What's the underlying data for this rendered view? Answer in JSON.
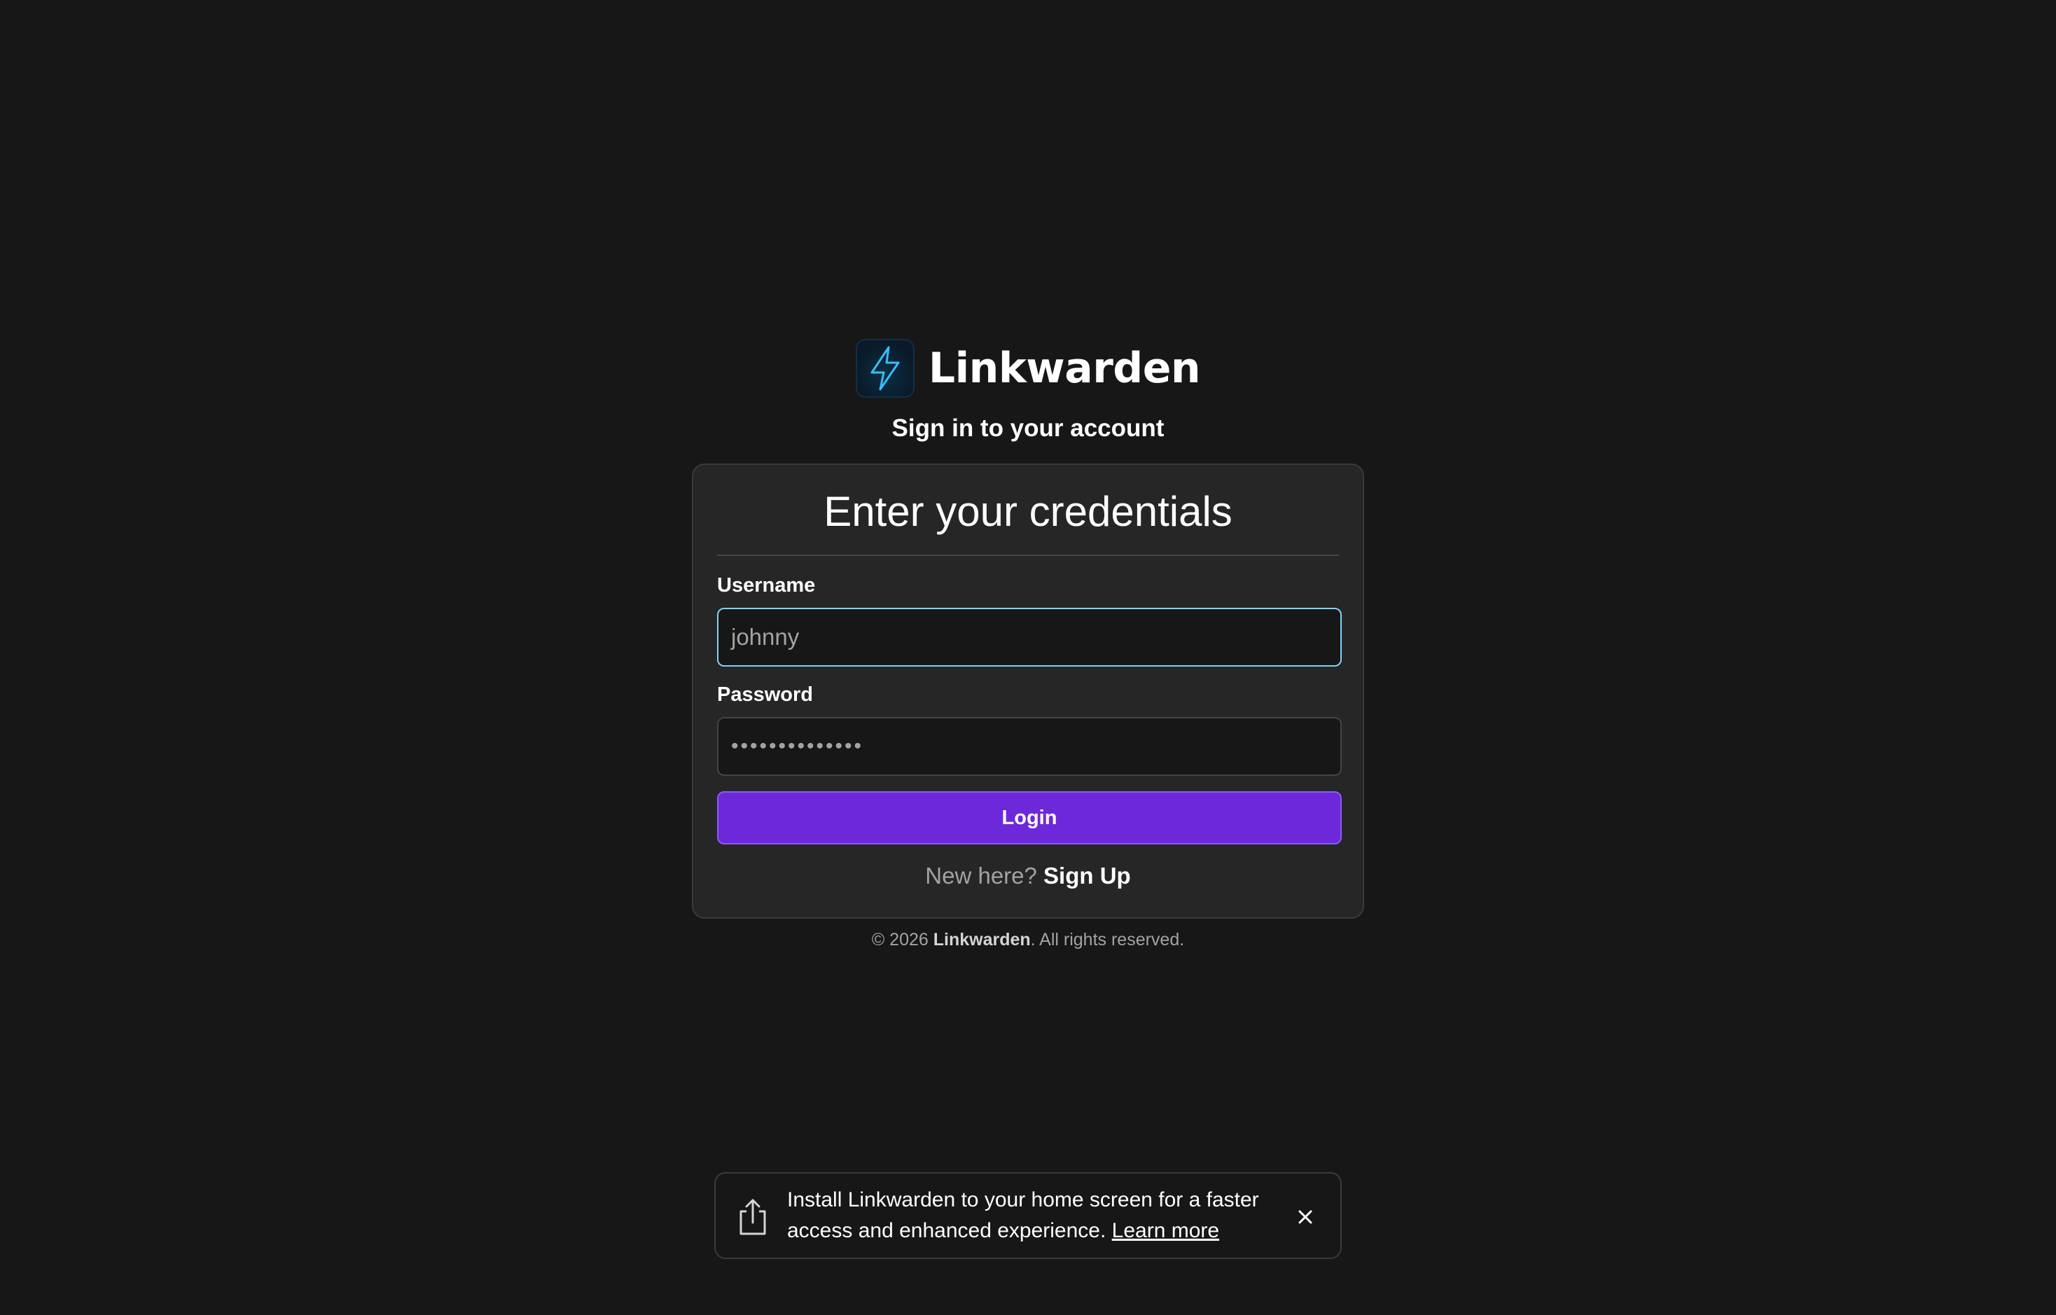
{
  "brand": {
    "name": "Linkwarden",
    "logo_icon": "lightning-bolt-icon",
    "accent_color": "#38bdf8"
  },
  "subtitle": "Sign in to your account",
  "card": {
    "title": "Enter your credentials",
    "username": {
      "label": "Username",
      "value": "johnny"
    },
    "password": {
      "label": "Password",
      "masked_value": "••••••••••••••"
    },
    "login_label": "Login",
    "signup_prompt": "New here?",
    "signup_link": "Sign Up"
  },
  "footer": {
    "prefix": "© 2026",
    "brand": "Linkwarden",
    "suffix": ". All rights reserved."
  },
  "install_banner": {
    "icon": "share-icon",
    "text": "Install Linkwarden to your home screen for a faster access and enhanced experience.",
    "link": "Learn more",
    "close_icon": "close-icon"
  },
  "colors": {
    "background": "#171717",
    "card": "#262626",
    "primary_button": "#6d28d9",
    "focus_ring": "#7dd3fc"
  }
}
